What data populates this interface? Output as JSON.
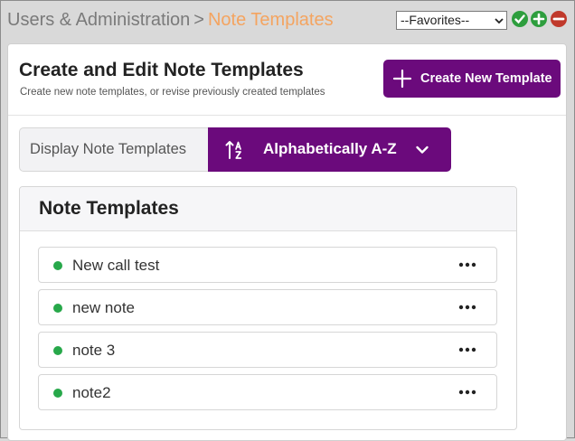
{
  "breadcrumb": {
    "parent": "Users & Administration",
    "separator": ">",
    "current": "Note Templates"
  },
  "favorites": {
    "selected": "--Favorites--"
  },
  "toolbar_icons": [
    "check-icon",
    "plus-icon",
    "minus-icon"
  ],
  "header": {
    "title": "Create and Edit Note Templates",
    "subtitle": "Create new note templates, or revise previously created templates",
    "create_button_label": "Create New Template"
  },
  "sort": {
    "label": "Display Note Templates",
    "selected": "Alphabetically A-Z"
  },
  "list": {
    "title": "Note Templates",
    "items": [
      {
        "name": "New call test",
        "status": "active"
      },
      {
        "name": "new note",
        "status": "active"
      },
      {
        "name": "note 3",
        "status": "active"
      },
      {
        "name": "note2",
        "status": "active"
      }
    ]
  },
  "colors": {
    "accent": "#6b0a7c",
    "breadcrumb_current": "#f4a460",
    "status_active": "#27a84a",
    "confirm": "#2e9e3e",
    "remove": "#c0392b"
  }
}
